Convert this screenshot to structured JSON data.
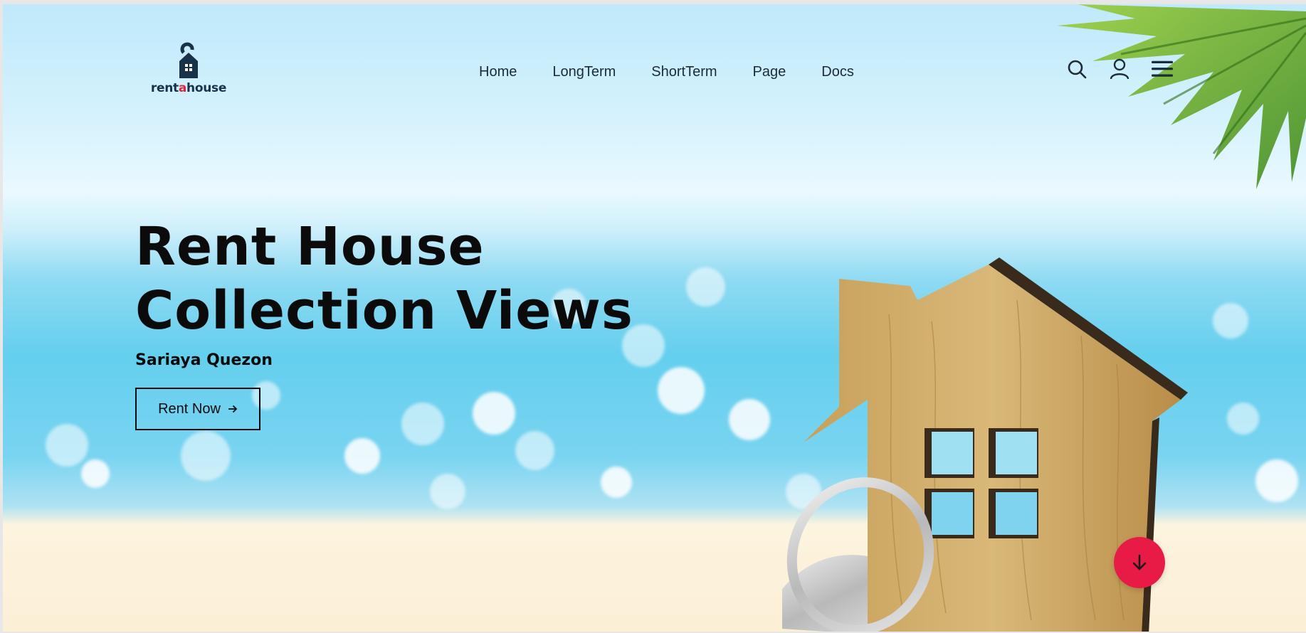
{
  "brand": {
    "logo_text_prefix": "rent",
    "logo_text_accent": "a",
    "logo_text_suffix": "house",
    "accent_color": "#e3243b"
  },
  "nav": {
    "items": [
      {
        "label": "Home"
      },
      {
        "label": "LongTerm"
      },
      {
        "label": "ShortTerm"
      },
      {
        "label": "Page"
      },
      {
        "label": "Docs"
      }
    ]
  },
  "header_icons": [
    "search-icon",
    "user-icon",
    "menu-icon"
  ],
  "hero": {
    "title_line1": "Rent House",
    "title_line2": "Collection Views",
    "subtitle": "Sariaya Quezon",
    "cta_label": "Rent Now",
    "cta_icon": "arrow-right-icon"
  },
  "scroll_button": {
    "icon": "arrow-down-icon",
    "color": "#e81b47"
  }
}
